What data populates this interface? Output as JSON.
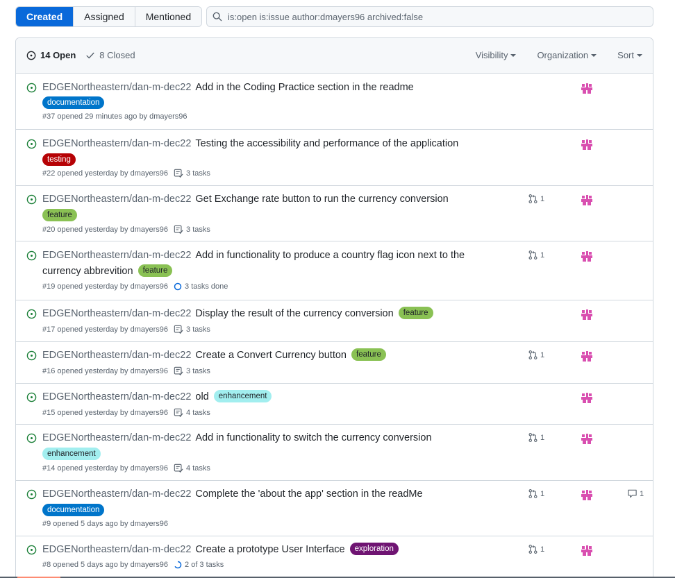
{
  "tabs": [
    {
      "label": "Created",
      "active": true
    },
    {
      "label": "Assigned",
      "active": false
    },
    {
      "label": "Mentioned",
      "active": false
    }
  ],
  "search": {
    "value": "is:open is:issue author:dmayers96 archived:false"
  },
  "header": {
    "open_label": "14 Open",
    "closed_label": "8 Closed",
    "filters": [
      "Visibility",
      "Organization",
      "Sort"
    ]
  },
  "colors": {
    "accent": "#0969da",
    "open_icon": "#1a7f37",
    "assignee": "#d94fb0"
  },
  "issues": [
    {
      "repo": "EDGENortheastern/dan-m-dec22",
      "title": "Add in the Coding Practice section in the readme",
      "labels": [
        {
          "name": "documentation",
          "bg": "#0075ca",
          "fg": "#ffffff"
        }
      ],
      "label_inline": false,
      "meta": "#37 opened 29 minutes ago by dmayers96",
      "tasks": "",
      "task_icon": "",
      "pr_count": "",
      "comments": ""
    },
    {
      "repo": "EDGENortheastern/dan-m-dec22",
      "title": "Testing the accessibility and performance of the application",
      "labels": [
        {
          "name": "testing",
          "bg": "#b60205",
          "fg": "#ffffff"
        }
      ],
      "label_inline": false,
      "meta": "#22 opened yesterday by dmayers96",
      "tasks": "3 tasks",
      "task_icon": "tasklist-icon",
      "pr_count": "",
      "comments": ""
    },
    {
      "repo": "EDGENortheastern/dan-m-dec22",
      "title": "Get Exchange rate button to run the currency conversion",
      "labels": [
        {
          "name": "feature",
          "bg": "#8ac154",
          "fg": "#1f2328"
        }
      ],
      "label_inline": false,
      "meta": "#20 opened yesterday by dmayers96",
      "tasks": "3 tasks",
      "task_icon": "tasklist-icon",
      "pr_count": "1",
      "comments": ""
    },
    {
      "repo": "EDGENortheastern/dan-m-dec22",
      "title": "Add in functionality to produce a country flag icon next to the currency abbrevition",
      "labels": [
        {
          "name": "feature",
          "bg": "#8ac154",
          "fg": "#1f2328"
        }
      ],
      "label_inline": true,
      "meta": "#19 opened yesterday by dmayers96",
      "tasks": "3 tasks done",
      "task_icon": "circle-icon",
      "pr_count": "1",
      "comments": ""
    },
    {
      "repo": "EDGENortheastern/dan-m-dec22",
      "title": "Display the result of the currency conversion",
      "labels": [
        {
          "name": "feature",
          "bg": "#8ac154",
          "fg": "#1f2328"
        }
      ],
      "label_inline": true,
      "meta": "#17 opened yesterday by dmayers96",
      "tasks": "3 tasks",
      "task_icon": "tasklist-icon",
      "pr_count": "",
      "comments": ""
    },
    {
      "repo": "EDGENortheastern/dan-m-dec22",
      "title": "Create a Convert Currency button",
      "labels": [
        {
          "name": "feature",
          "bg": "#8ac154",
          "fg": "#1f2328"
        }
      ],
      "label_inline": true,
      "meta": "#16 opened yesterday by dmayers96",
      "tasks": "3 tasks",
      "task_icon": "tasklist-icon",
      "pr_count": "1",
      "comments": ""
    },
    {
      "repo": "EDGENortheastern/dan-m-dec22",
      "title": "old",
      "labels": [
        {
          "name": "enhancement",
          "bg": "#a2eeef",
          "fg": "#1f2328"
        }
      ],
      "label_inline": true,
      "meta": "#15 opened yesterday by dmayers96",
      "tasks": "4 tasks",
      "task_icon": "tasklist-icon",
      "pr_count": "",
      "comments": ""
    },
    {
      "repo": "EDGENortheastern/dan-m-dec22",
      "title": "Add in functionality to switch the currency conversion",
      "labels": [
        {
          "name": "enhancement",
          "bg": "#a2eeef",
          "fg": "#1f2328"
        }
      ],
      "label_inline": false,
      "meta": "#14 opened yesterday by dmayers96",
      "tasks": "4 tasks",
      "task_icon": "tasklist-icon",
      "pr_count": "1",
      "comments": ""
    },
    {
      "repo": "EDGENortheastern/dan-m-dec22",
      "title": "Complete the 'about the app' section in the readMe",
      "labels": [
        {
          "name": "documentation",
          "bg": "#0075ca",
          "fg": "#ffffff"
        }
      ],
      "label_inline": false,
      "meta": "#9 opened 5 days ago by dmayers96",
      "tasks": "",
      "task_icon": "",
      "pr_count": "1",
      "comments": "1"
    },
    {
      "repo": "EDGENortheastern/dan-m-dec22",
      "title": "Create a prototype User Interface",
      "labels": [
        {
          "name": "exploration",
          "bg": "#6f1472",
          "fg": "#ffffff"
        }
      ],
      "label_inline": true,
      "meta": "#8 opened 5 days ago by dmayers96",
      "tasks": "2 of 3 tasks",
      "task_icon": "progress-icon",
      "pr_count": "1",
      "comments": ""
    }
  ]
}
